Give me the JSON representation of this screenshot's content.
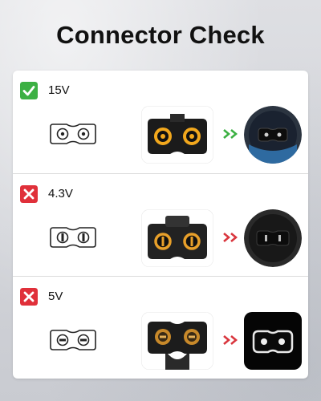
{
  "title": "Connector Check",
  "rows": [
    {
      "voltage": "15V",
      "status": "check-icon",
      "status_color": "#3cb043",
      "arrow_color": "#3cb043"
    },
    {
      "voltage": "4.3V",
      "status": "x-icon",
      "status_color": "#e0303a",
      "arrow_color": "#d9363e"
    },
    {
      "voltage": "5V",
      "status": "x-icon",
      "status_color": "#e0303a",
      "arrow_color": "#d9363e"
    }
  ]
}
